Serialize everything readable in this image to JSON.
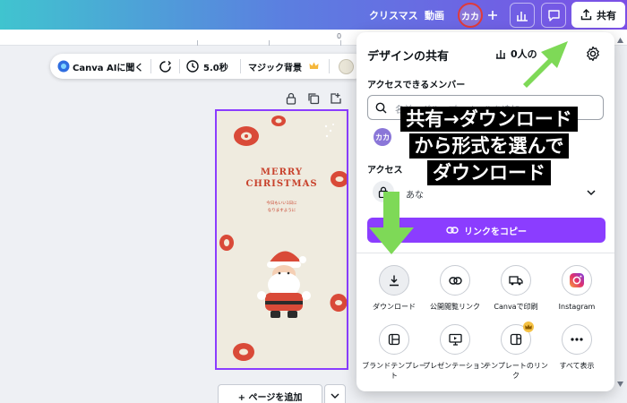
{
  "topbar": {
    "link1": "クリスマス",
    "link2": "動画",
    "avatar": "カカ",
    "share_label": "共有",
    "colors": {
      "gradient_start": "#40c4cf",
      "gradient_end": "#7b4fe6"
    }
  },
  "ruler": {
    "mark": "0"
  },
  "edit_toolbar": {
    "ai_label": "Canva AIに聞く",
    "duration": "5.0秒",
    "magic_bg": "マジック背景"
  },
  "design": {
    "title_line1": "MERRY",
    "title_line2": "CHRISTMAS",
    "sub_line1": "今日もいい1日に",
    "sub_line2": "なりますように"
  },
  "add_page": {
    "label": "+ ページを追加"
  },
  "share_panel": {
    "title": "デザインの共有",
    "member_count": "0人の",
    "members_heading": "アクセスできるメンバー",
    "search_placeholder": "名前、グループ、メールを追加",
    "member_avatar": "カカ",
    "access_heading": "アクセス",
    "access_value": "あな",
    "copy_link": "リンクをコピー",
    "options": [
      {
        "label": "ダウンロード",
        "icon": "download-icon"
      },
      {
        "label": "公開閲覧リンク",
        "icon": "link-icon"
      },
      {
        "label": "Canvaで印刷",
        "icon": "truck-icon"
      },
      {
        "label": "Instagram",
        "icon": "instagram-icon"
      },
      {
        "label": "ブランドテンプレート",
        "icon": "brand-template-icon"
      },
      {
        "label": "プレゼンテーション",
        "icon": "presentation-icon"
      },
      {
        "label": "テンプレートのリンク",
        "icon": "template-link-icon"
      },
      {
        "label": "すべて表示",
        "icon": "more-icon"
      }
    ],
    "colors": {
      "accent": "#8b3dff",
      "crown": "#f5c143"
    }
  },
  "annotation": {
    "line1": "共有→ダウンロード",
    "line2": "から形式を選んで",
    "line3": "ダウンロード",
    "arrow_color": "#7ed957"
  }
}
